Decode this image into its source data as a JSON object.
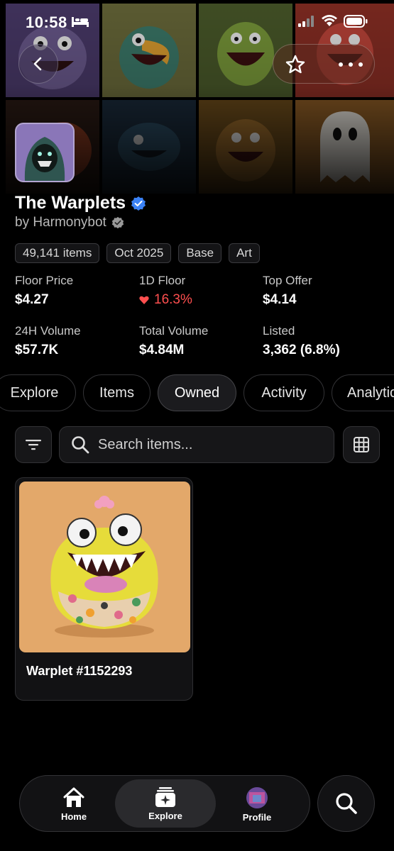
{
  "status_bar": {
    "time": "10:58"
  },
  "collection": {
    "name": "The Warplets",
    "creator": "by Harmonybot",
    "tags": [
      "49,141 items",
      "Oct 2025",
      "Base",
      "Art"
    ]
  },
  "stats": {
    "floor_price": {
      "label": "Floor Price",
      "value": "$4.27"
    },
    "one_day_floor": {
      "label": "1D Floor",
      "value": "16.3%"
    },
    "top_offer": {
      "label": "Top Offer",
      "value": "$4.14"
    },
    "volume_24h": {
      "label": "24H Volume",
      "value": "$57.7K"
    },
    "total_volume": {
      "label": "Total Volume",
      "value": "$4.84M"
    },
    "listed": {
      "label": "Listed",
      "value": "3,362 (6.8%)"
    }
  },
  "tabs": [
    "Explore",
    "Items",
    "Owned",
    "Activity",
    "Analytics"
  ],
  "active_tab": "Owned",
  "search": {
    "placeholder": "Search items..."
  },
  "items": [
    {
      "name": "Warplet #1152293"
    }
  ],
  "nav": {
    "home": "Home",
    "explore": "Explore",
    "profile": "Profile"
  },
  "colors": {
    "accent_negative": "#ff4f4f",
    "verified": "#3b82f6",
    "card_bg": "#e3a86a"
  }
}
